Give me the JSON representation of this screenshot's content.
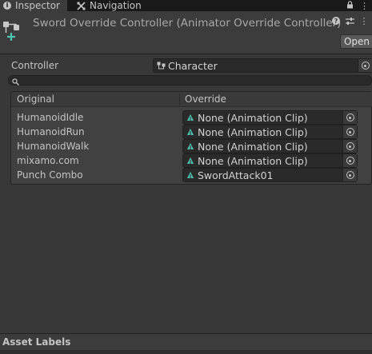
{
  "tabs": [
    {
      "label": "Inspector",
      "icon": "info-icon"
    },
    {
      "label": "Navigation",
      "icon": "navigation-icon"
    }
  ],
  "tabbar_icons": [
    "lock-icon",
    "more-icon"
  ],
  "header": {
    "title": "Sword Override Controller (Animator Override Controller)",
    "icons": [
      "help-icon",
      "settings-sliders-icon",
      "more-icon"
    ],
    "open_label": "Open"
  },
  "controller": {
    "label": "Controller",
    "value": "Character",
    "icon": "animator-controller-icon"
  },
  "search": {
    "value": "",
    "icon": "search-icon"
  },
  "overrides": {
    "col_original": "Original",
    "col_override": "Override",
    "rows": [
      {
        "original": "HumanoidIdle",
        "override": "None (Animation Clip)"
      },
      {
        "original": "HumanoidRun",
        "override": "None (Animation Clip)"
      },
      {
        "original": "HumanoidWalk",
        "override": "None (Animation Clip)"
      },
      {
        "original": "mixamo.com",
        "override": "None (Animation Clip)"
      },
      {
        "original": "Punch Combo",
        "override": "SwordAttack01"
      }
    ]
  },
  "asset_labels": {
    "label": "Asset Labels"
  },
  "colors": {
    "background": "#383838",
    "tab_bar": "#191919",
    "field_bg": "#2a2a2a",
    "accent_cyan": "#4fc3b0",
    "text": "#c4c4c4"
  }
}
